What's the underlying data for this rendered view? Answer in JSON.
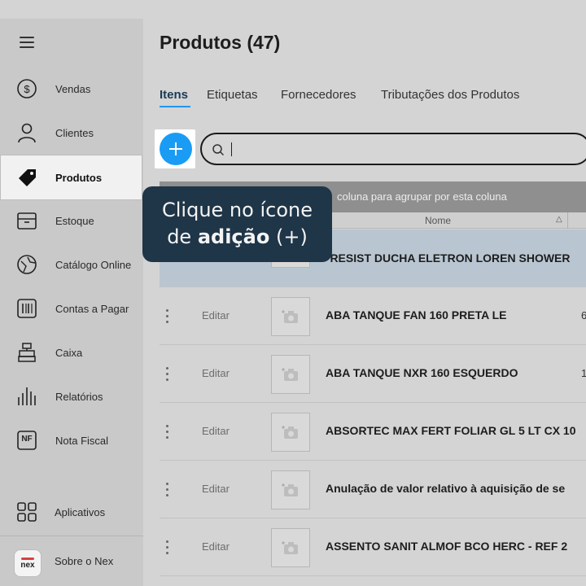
{
  "sidebar": {
    "items": [
      {
        "label": "Vendas",
        "icon": "dollar-icon"
      },
      {
        "label": "Clientes",
        "icon": "user-icon"
      },
      {
        "label": "Produtos",
        "icon": "tag-icon",
        "active": true
      },
      {
        "label": "Estoque",
        "icon": "box-icon"
      },
      {
        "label": "Catálogo Online",
        "icon": "catalog-icon"
      },
      {
        "label": "Contas a Pagar",
        "icon": "barcode-icon"
      },
      {
        "label": "Caixa",
        "icon": "cash-register-icon"
      },
      {
        "label": "Relatórios",
        "icon": "bar-chart-icon"
      },
      {
        "label": "Nota Fiscal",
        "icon": "nf-icon",
        "badge": "NF"
      }
    ],
    "apps_label": "Aplicativos",
    "about_label": "Sobre o Nex",
    "logo_text": "nex"
  },
  "page": {
    "title": "Produtos (47)"
  },
  "tabs": [
    {
      "label": "Itens",
      "active": true
    },
    {
      "label": "Etiquetas"
    },
    {
      "label": "Fornecedores"
    },
    {
      "label": "Tributações dos Produtos"
    }
  ],
  "search": {
    "value": ""
  },
  "grid": {
    "group_hint": "coluna para agrupar por esta coluna",
    "column_name": "Nome",
    "sort_indicator": "△",
    "edit_label": "Editar",
    "rows": [
      {
        "name": "*RESIST DUCHA ELETRON LOREN SHOWER",
        "extra": "",
        "selected": true
      },
      {
        "name": "ABA TANQUE FAN 160 PRETA LE",
        "extra": "6"
      },
      {
        "name": "ABA TANQUE NXR 160 ESQUERDO",
        "extra": "1"
      },
      {
        "name": "ABSORTEC MAX FERT FOLIAR GL 5 LT CX 10",
        "extra": ""
      },
      {
        "name": "Anulação de valor relativo à aquisição de se",
        "extra": ""
      },
      {
        "name": "ASSENTO SANIT ALMOF BCO HERC  -  REF 2",
        "extra": ""
      }
    ]
  },
  "tooltip": {
    "line1": "Clique no ícone",
    "line2_prefix": "de ",
    "line2_bold": "adição",
    "line2_suffix": " (+)"
  },
  "colors": {
    "accent": "#1a9cf5",
    "tooltip_bg": "#1f3548",
    "overlay": "#d4d4d4"
  }
}
